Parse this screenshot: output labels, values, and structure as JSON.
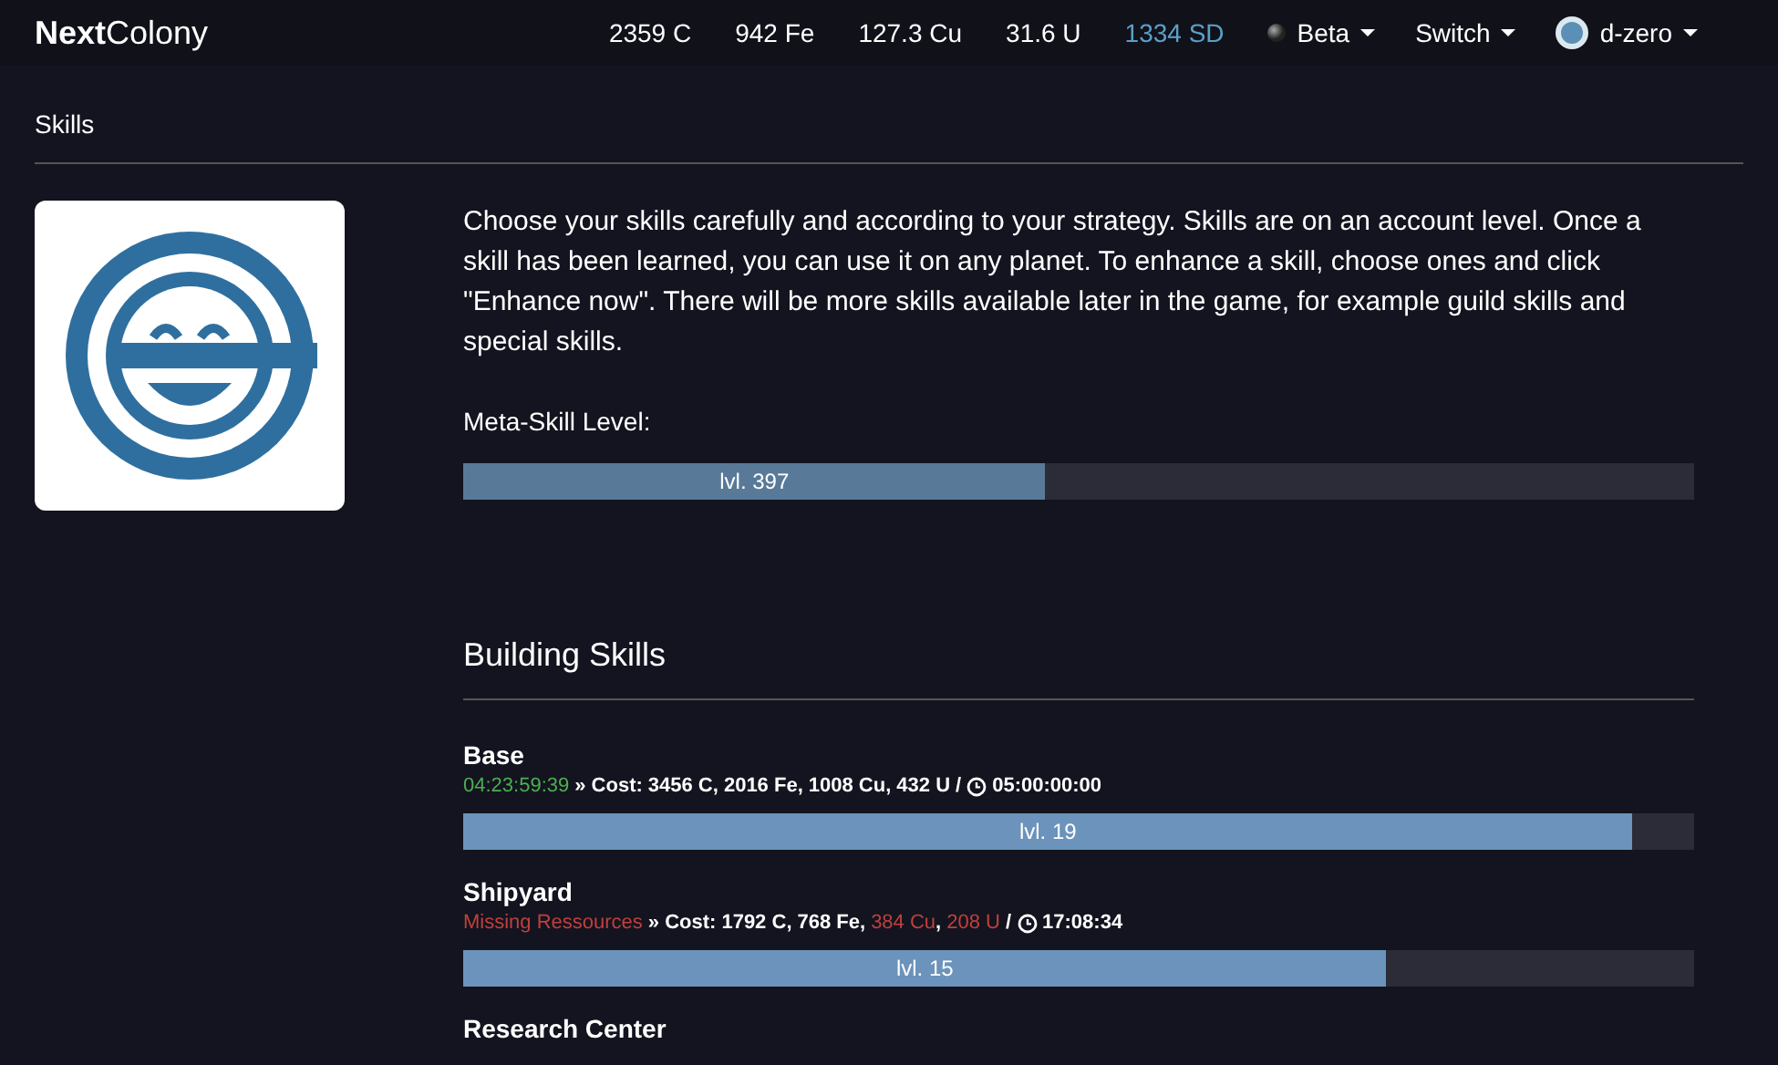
{
  "brand": {
    "bold": "Next",
    "rest": "Colony"
  },
  "resources": [
    {
      "text": "2359 C",
      "kind": "plain"
    },
    {
      "text": "942 Fe",
      "kind": "plain"
    },
    {
      "text": "127.3 Cu",
      "kind": "plain"
    },
    {
      "text": "31.6 U",
      "kind": "plain"
    },
    {
      "text": "1334 SD",
      "kind": "accent"
    }
  ],
  "menus": [
    {
      "label": "Beta"
    },
    {
      "label": "Switch"
    },
    {
      "label": "d-zero"
    }
  ],
  "page_title": "Skills",
  "intro": "Choose your skills carefully and according to your strategy. Skills are on an account level. Once a skill has been learned, you can use it on any planet. To enhance a skill, choose ones and click \"Enhance now\". There will be more skills available later in the game, for example guild skills and special skills.",
  "meta": {
    "label": "Meta-Skill Level:",
    "bar_text": "lvl. 397",
    "level": 0.473
  },
  "section_title": "Building Skills",
  "skills": [
    {
      "name": "Base",
      "status": {
        "kind": "timer",
        "text": "04:23:59:39"
      },
      "separator": "» Cost:",
      "costs": [
        {
          "text": "3456 C",
          "missing": false
        },
        {
          "text": ",",
          "missing": false
        },
        {
          "text": "2016 Fe",
          "missing": false
        },
        {
          "text": ",",
          "missing": false
        },
        {
          "text": "1008 Cu",
          "missing": false
        },
        {
          "text": ",",
          "missing": false
        },
        {
          "text": "432 U",
          "missing": false
        }
      ],
      "slash": "/",
      "duration": "05:00:00:00",
      "bar_text": "lvl. 19",
      "level": 0.95
    },
    {
      "name": "Shipyard",
      "status": {
        "kind": "missing",
        "text": "Missing Ressources"
      },
      "separator": "» Cost:",
      "costs": [
        {
          "text": "1792 C",
          "missing": false
        },
        {
          "text": ",",
          "missing": false
        },
        {
          "text": "768 Fe",
          "missing": false
        },
        {
          "text": ",",
          "missing": false
        },
        {
          "text": "384 Cu",
          "missing": true
        },
        {
          "text": ",",
          "missing": false
        },
        {
          "text": "208 U",
          "missing": true
        }
      ],
      "slash": "/",
      "duration": "17:08:34",
      "bar_text": "lvl. 15",
      "level": 0.75
    },
    {
      "name": "Research Center"
    }
  ]
}
